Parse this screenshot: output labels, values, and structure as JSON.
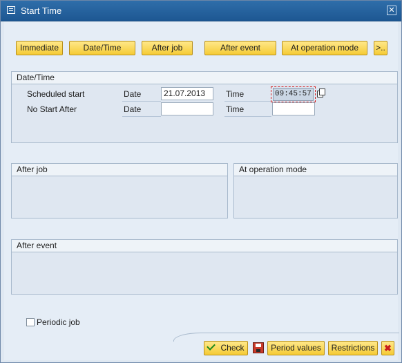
{
  "window": {
    "title": "Start Time",
    "close_glyph": "✕"
  },
  "toolbar": {
    "immediate": "Immediate",
    "date_time": "Date/Time",
    "after_job": "After job",
    "after_event": "After event",
    "at_operation_mode": "At operation mode",
    "more": ">.."
  },
  "date_time_group": {
    "header": "Date/Time",
    "scheduled_start_label": "Scheduled start",
    "no_start_after_label": "No Start After",
    "date_label": "Date",
    "time_label": "Time",
    "scheduled_start_date": "21.07.2013",
    "scheduled_start_time": "09:45:57",
    "no_start_after_date": "",
    "no_start_after_time": ""
  },
  "after_job_group": {
    "header": "After job"
  },
  "at_operation_mode_group": {
    "header": "At operation mode"
  },
  "after_event_group": {
    "header": "After event"
  },
  "periodic_job": {
    "label": "Periodic job",
    "checked": false
  },
  "footer": {
    "check": "Check",
    "period_values": "Period values",
    "restrictions": "Restrictions",
    "cancel_glyph": "✖"
  },
  "icons": {
    "title": "window-icon",
    "copy": "copy-icon",
    "save": "save-icon",
    "check": "check-icon",
    "cancel": "cancel-icon"
  },
  "colors": {
    "title_bar": "#1d5792",
    "button": "#f5cb35",
    "background": "#e5edf6",
    "focus": "#d42020"
  }
}
